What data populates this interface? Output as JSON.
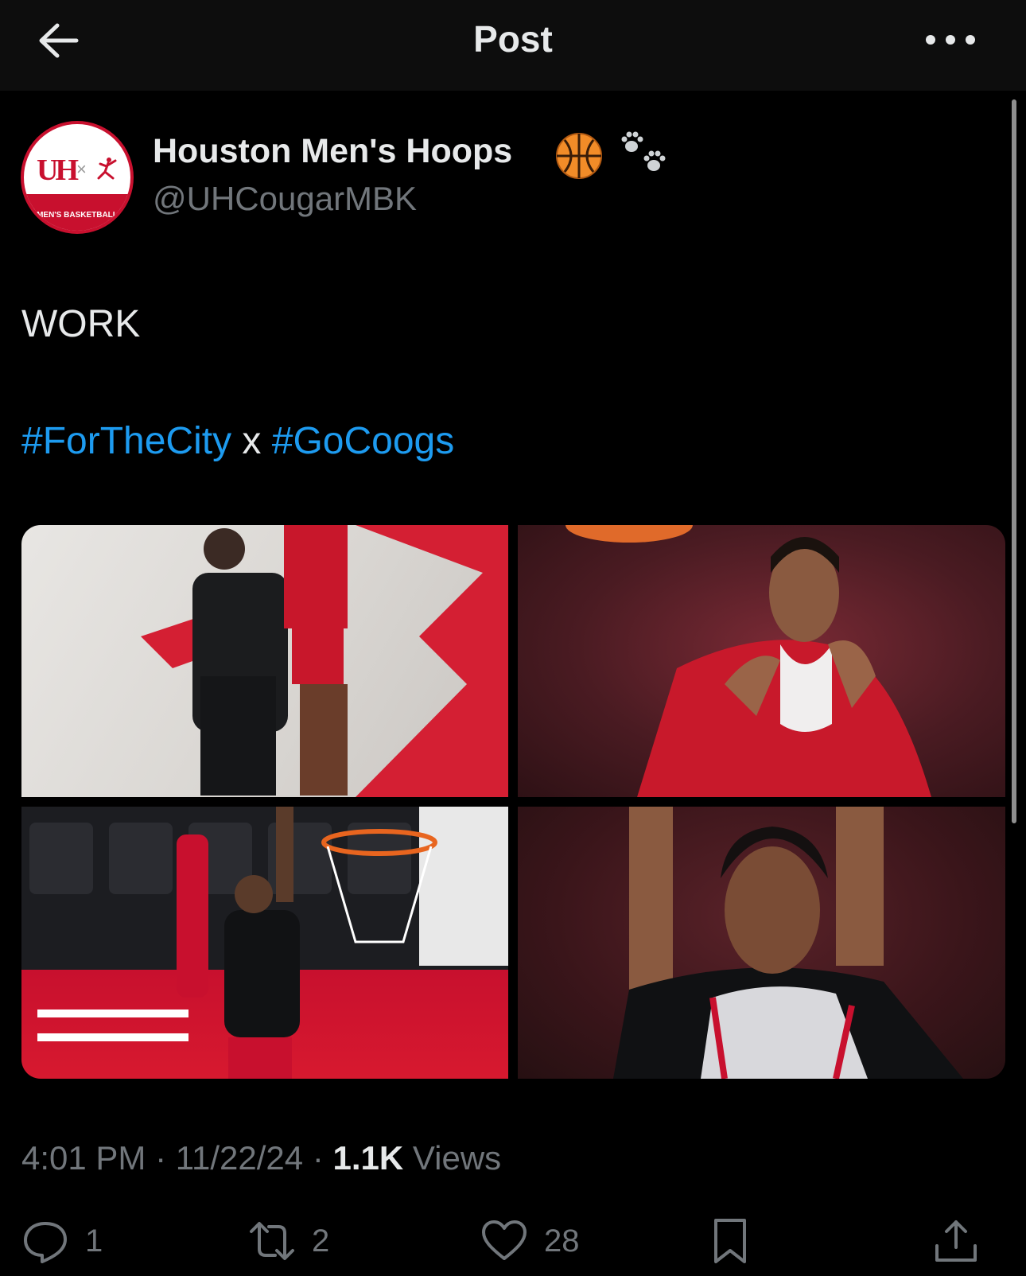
{
  "header": {
    "title": "Post",
    "back_icon": "arrow-left-icon",
    "more_icon": "more-icon"
  },
  "author": {
    "display_name": "Houston Men's Hoops",
    "emoji_1": "basketball-icon",
    "emoji_2": "paw-prints-icon",
    "handle": "@UHCougarMBK",
    "avatar": {
      "logo_text": "UH",
      "separator": "×",
      "band_text": "MEN'S BASKETBALL",
      "brand_color": "#c8102e"
    }
  },
  "post": {
    "text_line_1": "WORK",
    "hashtag_1": "#ForTheCity",
    "connector": "x",
    "hashtag_2": "#GoCoogs",
    "link_color": "#1d9bf0",
    "photos": [
      "photo-practice-coach-and-player",
      "photo-player-shooting-form-red-jersey",
      "photo-player-layup-at-basket",
      "photo-player-free-throw-black-jersey"
    ]
  },
  "meta": {
    "time": "4:01 PM",
    "sep1": "·",
    "date": "11/22/24",
    "sep2": "·",
    "views_count": "1.1K",
    "views_label": "Views"
  },
  "actions": {
    "replies": "1",
    "reposts": "2",
    "likes": "28"
  }
}
